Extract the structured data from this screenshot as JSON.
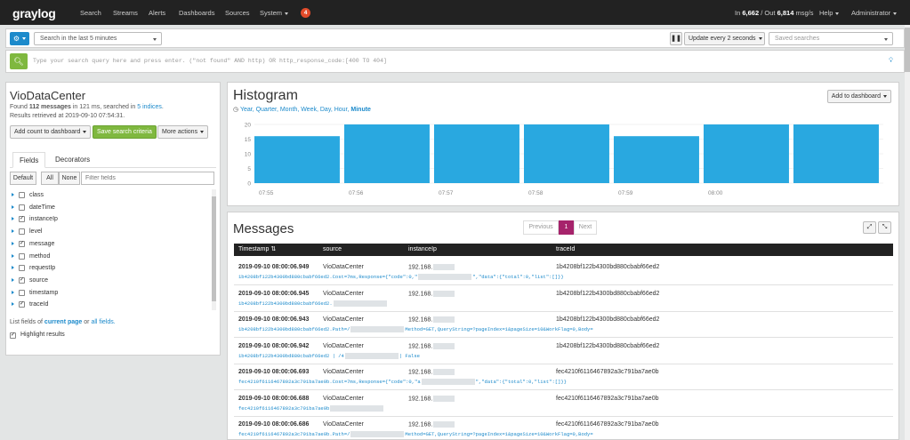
{
  "nav": {
    "logo_gray": "gray",
    "logo_log": "log",
    "items": [
      "Search",
      "Streams",
      "Alerts",
      "Dashboards",
      "Sources",
      "System"
    ],
    "notification_count": "4",
    "throughput_in_label": "In",
    "throughput_in": "6,662",
    "throughput_out_label": "/ Out",
    "throughput_out": "6,814",
    "throughput_unit": "msg/s",
    "help": "Help",
    "user": "Administrator"
  },
  "search": {
    "options_icon": "gear-icon",
    "range": "Search in the last 5 minutes",
    "pause_icon": "pause-icon",
    "update": "Update every 2 seconds",
    "saved_searches_placeholder": "Saved searches",
    "query_placeholder": "Type your search query here and press enter. (\"not found\" AND http) OR http_response_code:[400 TO 404]"
  },
  "sidebar": {
    "title": "VioDataCenter",
    "found_prefix": "Found",
    "found_count": "112 messages",
    "found_mid": "in 121 ms, searched in",
    "indices": "5 indices",
    "retrieved": "Results retrieved at 2019-09-10 07:54:31.",
    "add_count": "Add count to dashboard",
    "save_criteria": "Save search criteria",
    "more_actions": "More actions",
    "tabs": [
      "Fields",
      "Decorators"
    ],
    "filter_buttons": [
      "Default",
      "All",
      "None"
    ],
    "filter_placeholder": "Filter fields",
    "fields": [
      {
        "name": "class",
        "checked": false
      },
      {
        "name": "dateTime",
        "checked": false
      },
      {
        "name": "instanceIp",
        "checked": true
      },
      {
        "name": "level",
        "checked": false
      },
      {
        "name": "message",
        "checked": true
      },
      {
        "name": "method",
        "checked": false
      },
      {
        "name": "requestIp",
        "checked": false
      },
      {
        "name": "source",
        "checked": true
      },
      {
        "name": "timestamp",
        "checked": false
      },
      {
        "name": "traceId",
        "checked": true
      }
    ],
    "list_fields_prefix": "List fields of",
    "current_page": "current page",
    "list_fields_or": "or",
    "all_fields": "all fields.",
    "highlight": "Highlight results"
  },
  "histogram": {
    "title": "Histogram",
    "resolutions": [
      "Year",
      "Quarter",
      "Month",
      "Week",
      "Day",
      "Hour",
      "Minute"
    ],
    "selected_resolution": "Minute",
    "add_to_dashboard": "Add to dashboard"
  },
  "chart_data": {
    "type": "bar",
    "categories": [
      "07:55",
      "07:56",
      "07:57",
      "07:58",
      "07:59",
      "08:00"
    ],
    "values": [
      16,
      20,
      20,
      20,
      16,
      20,
      20
    ],
    "bar_color": "#29a8e0",
    "yticks": [
      "20",
      "15",
      "10",
      "5",
      "0"
    ],
    "ylim": [
      0,
      20
    ],
    "grid": true
  },
  "messages": {
    "title": "Messages",
    "pager": {
      "previous": "Previous",
      "current": "1",
      "next": "Next"
    },
    "columns": [
      "Timestamp",
      "source",
      "instanceIp",
      "traceId"
    ],
    "rows": [
      {
        "ts": "2019-09-10 08:00:06.949",
        "source": "VioDataCenter",
        "ip": "192.168.",
        "trace": "1b4208bf122b4300bd880cbabf66ed2",
        "msg_a": "1b4208bf122b4300bd880cbabf66ed2.Cost=7ms,Response={\"code\":0,\"",
        "msg_b": "\",\"data\":{\"total\":0,\"list\":[]}}"
      },
      {
        "ts": "2019-09-10 08:00:06.945",
        "source": "VioDataCenter",
        "ip": "192.168.",
        "trace": "1b4208bf122b4300bd880cbabf66ed2",
        "msg_a": "1b4208bf122b4300bd880cbabf66ed2.",
        "msg_b": ""
      },
      {
        "ts": "2019-09-10 08:00:06.943",
        "source": "VioDataCenter",
        "ip": "192.168.",
        "trace": "1b4208bf122b4300bd880cbabf66ed2",
        "msg_a": "1b4208bf122b4300bd880cbabf66ed2.Path=/",
        "msg_b": "Method=GET,QueryString=?pageIndex=1&pageSize=10&WorkFlag=0,Body="
      },
      {
        "ts": "2019-09-10 08:00:06.942",
        "source": "VioDataCenter",
        "ip": "192.168.",
        "trace": "1b4208bf122b4300bd880cbabf66ed2",
        "msg_a": "1b4208bf122b4300bd880cbabf66ed2 | /4",
        "msg_b": "| False"
      },
      {
        "ts": "2019-09-10 08:00:06.693",
        "source": "VioDataCenter",
        "ip": "192.168.",
        "trace": "fec4210f6116467892a3c791ba7ae0b",
        "msg_a": "fec4210f6116467892a3c791ba7ae0b.Cost=7ms,Response={\"code\":0,\"a",
        "msg_b": "\",\"data\":{\"total\":0,\"list\":[]}}"
      },
      {
        "ts": "2019-09-10 08:00:06.688",
        "source": "VioDataCenter",
        "ip": "192.168.",
        "trace": "fec4210f6116467892a3c791ba7ae0b",
        "msg_a": "fec4210f6116467892a3c791ba7ae0b",
        "msg_b": ""
      },
      {
        "ts": "2019-09-10 08:00:06.686",
        "source": "VioDataCenter",
        "ip": "192.168.",
        "trace": "fec4210f6116467892a3c791ba7ae0b",
        "msg_a": "fec4210f6116467892a3c791ba7ae0b.Path=/",
        "msg_b": "Method=GET,QueryString=?pageIndex=1&pageSize=10&WorkFlag=0,Body="
      }
    ]
  }
}
